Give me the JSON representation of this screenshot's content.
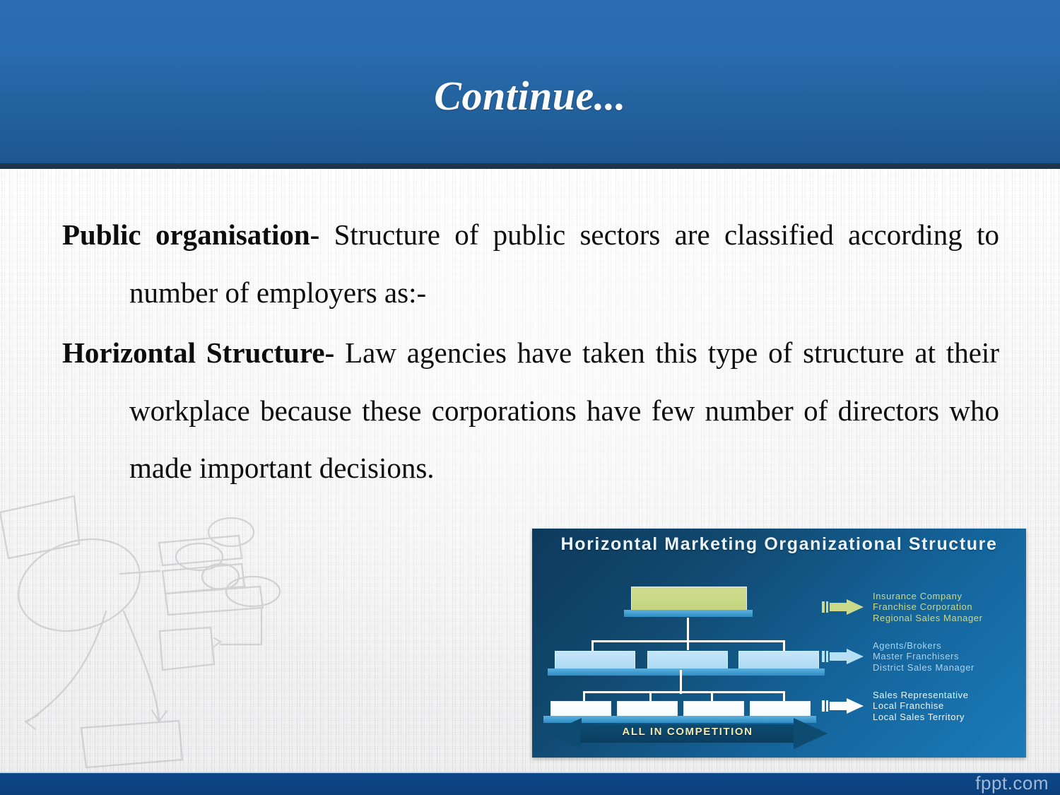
{
  "slide": {
    "title": "Continue...",
    "watermark": "fppt.com"
  },
  "content": {
    "paragraphs": [
      {
        "lead": "Public organisation-",
        "rest": " Structure of public sectors are classified according to number of employers  as:-"
      },
      {
        "lead": "Horizontal Structure-",
        "rest": " Law agencies have taken this type of structure at their workplace because these corporations have few number of directors who made important decisions."
      }
    ]
  },
  "picture": {
    "title": "Horizontal Marketing Organizational Structure",
    "banner_label": "ALL IN COMPETITION",
    "colors": {
      "top_node": "#cbd98a",
      "mid_node": "#b8e0f5",
      "leaf_node": "#ffffff",
      "background_dark": "#0c3a5c",
      "background_light": "#1b7bb8",
      "banner_text": "#f2e9b4"
    },
    "legend": [
      {
        "arrow_color": "#cbd98a",
        "text_color": "#c9d98f",
        "lines": [
          "Insurance Company",
          "Franchise Corporation",
          "Regional Sales Manager"
        ]
      },
      {
        "arrow_color": "#b8e0f5",
        "text_color": "#a9d3ef",
        "lines": [
          "Agents/Brokers",
          "Master Franchisers",
          "District Sales Manager"
        ]
      },
      {
        "arrow_color": "#ffffff",
        "text_color": "#eef6fb",
        "lines": [
          "Sales Representative",
          "Local Franchise",
          "Local Sales Territory"
        ]
      }
    ],
    "chart": {
      "levels": [
        {
          "name": "top",
          "count": 1
        },
        {
          "name": "middle",
          "count": 3
        },
        {
          "name": "bottom",
          "count": 4
        }
      ]
    }
  },
  "theme": {
    "header_blue": "#2a6cb0",
    "header_rule": "#1e3448",
    "footer_blue": "#0d4580",
    "paper": "#ededee",
    "text": "#0c0c0c"
  }
}
